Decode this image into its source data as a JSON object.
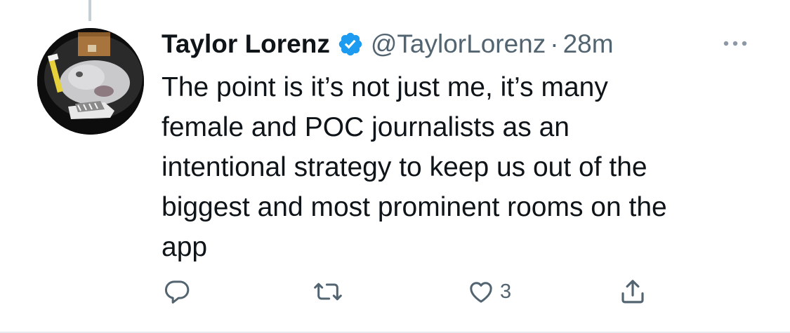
{
  "tweet": {
    "display_name": "Taylor Lorenz",
    "handle": "@TaylorLorenz",
    "separator": "·",
    "time": "28m",
    "text": "The point is it’s not just me, it’s many\nfemale and POC journalists as an\nintentional strategy to keep us out of the\nbiggest and most prominent rooms on the\napp",
    "verified": true,
    "avatar": "profile-photo"
  },
  "actions": {
    "reply_icon": "reply-icon",
    "retweet_icon": "retweet-icon",
    "like_icon": "heart-icon",
    "like_count": "3",
    "share_icon": "share-icon"
  },
  "colors": {
    "verified_blue": "#1d9bf0",
    "secondary_text": "#536471",
    "primary_text": "#0f1419",
    "thread_line": "#c4cfd6"
  }
}
